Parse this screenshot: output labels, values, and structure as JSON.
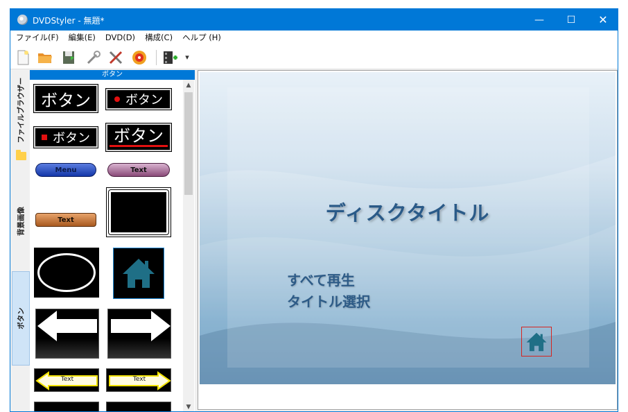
{
  "window": {
    "title": "DVDStyler - 無題*",
    "controls": {
      "minimize": "—",
      "maximize": "☐",
      "close": "✕"
    }
  },
  "menubar": {
    "items": [
      "ファイル(F)",
      "編集(E)",
      "DVD(D)",
      "構成(C)",
      "ヘルプ (H)"
    ]
  },
  "toolbar": {
    "icons": [
      "new-icon",
      "open-icon",
      "save-icon",
      "settings-icon",
      "tools-icon",
      "burn-icon",
      "add-video-icon",
      "dropdown-arrow-icon"
    ],
    "dropdown_arrow": "▾"
  },
  "side_tabs": {
    "file_browser": "ファイルブラウザー",
    "backgrounds": "背景画像",
    "buttons": "ボタン"
  },
  "palette": {
    "header": "ボタン",
    "items": {
      "big_text": "ボタン",
      "dot_text": "ボタン",
      "square_text": "ボタン",
      "underlined_text": "ボタン",
      "blue_pill": "Menu",
      "pink_pill": "Text",
      "orange_pill": "Text",
      "yellow_arrow_left": "Text",
      "yellow_arrow_right": "Text"
    }
  },
  "scrollbar": {
    "up": "▲",
    "down": "▼"
  },
  "preview": {
    "disc_title": "ディスクタイトル",
    "play_all": "すべて再生",
    "title_select": "タイトル選択"
  },
  "colors": {
    "accent": "#0078d7",
    "home_icon": "#1f6f86",
    "selection_border": "#d6241f",
    "menu_text": "#2d5b87"
  }
}
